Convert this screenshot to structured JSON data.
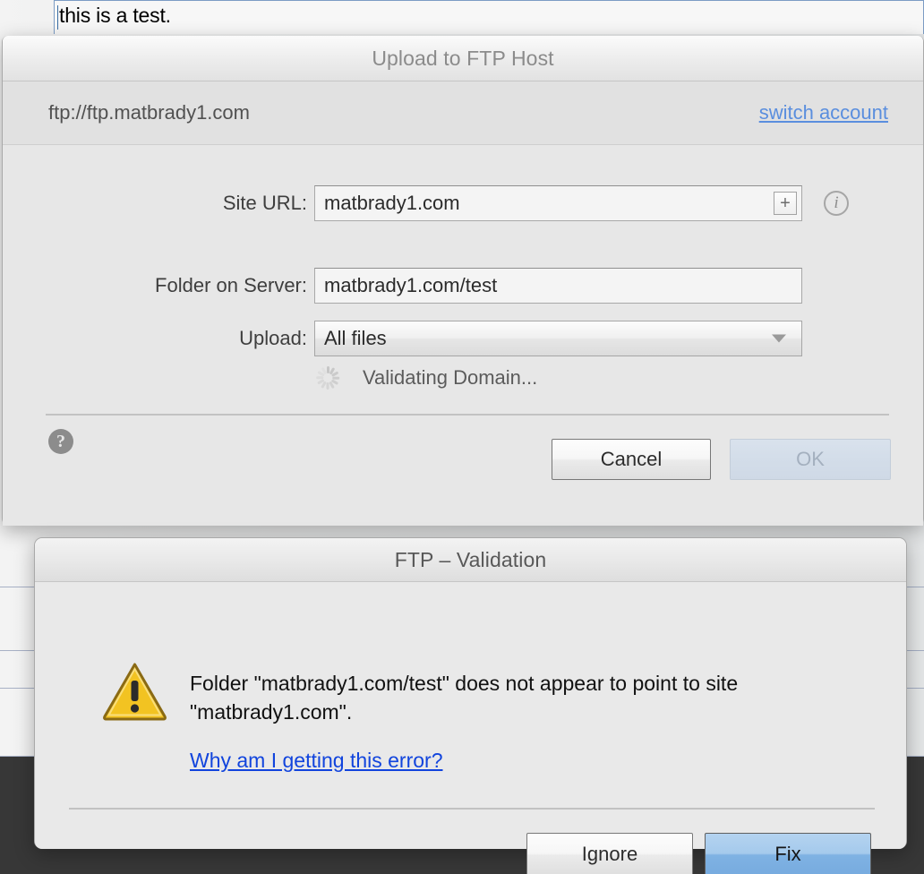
{
  "background": {
    "editor_text": "this is a test."
  },
  "ftp_dialog": {
    "title": "Upload to FTP Host",
    "account_url": "ftp://ftp.matbrady1.com",
    "switch_account_label": "switch account",
    "fields": {
      "site_url": {
        "label": "Site URL:",
        "value": "matbrady1.com",
        "add_button_label": "+",
        "info_icon": "info-icon",
        "info_glyph": "i"
      },
      "folder_on_server": {
        "label": "Folder on Server:",
        "value": "matbrady1.com/test"
      },
      "upload": {
        "label": "Upload:",
        "value": "All files",
        "options": [
          "All files"
        ]
      }
    },
    "status": {
      "icon": "spinner-icon",
      "text": "Validating Domain..."
    },
    "help_button_label": "?",
    "buttons": {
      "cancel": "Cancel",
      "ok": "OK"
    }
  },
  "alert_dialog": {
    "title": "FTP – Validation",
    "icon": "warning-triangle-icon",
    "message": "Folder \"matbrady1.com/test\" does not appear to point to site \"matbrady1.com\".",
    "link_label": "Why am I getting this error?",
    "buttons": {
      "ignore": "Ignore",
      "fix": "Fix"
    }
  },
  "colors": {
    "link_blue": "#1144dd",
    "switch_account_blue": "#5a8ede",
    "default_button_blue": "#7fb2e3",
    "warning_yellow": "#f5c526",
    "sheet_gray": "#e7e7e7"
  }
}
